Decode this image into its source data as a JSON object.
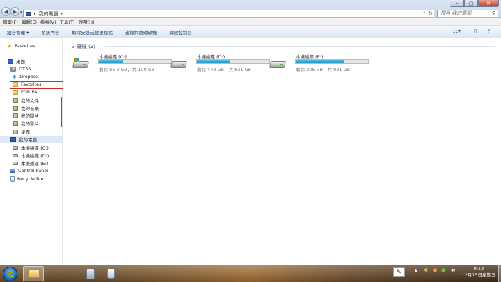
{
  "window": {
    "address_path": "我的電腦",
    "search_placeholder": "搜尋 我的電腦",
    "controls": {
      "minimize": "–",
      "maximize": "▢",
      "close": "✕"
    }
  },
  "menu": [
    "檔案(F)",
    "編輯(E)",
    "檢視(V)",
    "工具(T)",
    "說明(H)"
  ],
  "toolbar": [
    "組合管理 ▾",
    "系統內容",
    "解除安裝或變更程式",
    "連線網路磁碟機",
    "開啟控制台"
  ],
  "sidebar": {
    "favorites_header": "Favorites",
    "items": [
      {
        "label": "桌面",
        "icon": "desktop-icon"
      },
      {
        "label": "DTSS",
        "icon": "user-folder-icon"
      },
      {
        "label": "Dropbox",
        "icon": "dropbox-icon"
      },
      {
        "label": "Favorites",
        "icon": "folder-icon"
      },
      {
        "label": "FOR PA",
        "icon": "folder-icon"
      },
      {
        "label": "我的文件",
        "icon": "library-icon"
      },
      {
        "label": "我的音樂",
        "icon": "library-icon"
      },
      {
        "label": "我的圖片",
        "icon": "library-icon"
      },
      {
        "label": "我的影片",
        "icon": "library-icon"
      },
      {
        "label": "桌面",
        "icon": "library-icon"
      },
      {
        "label": "我的電腦",
        "icon": "computer-icon"
      },
      {
        "label": "本機磁碟 (C:)",
        "icon": "drive-icon"
      },
      {
        "label": "本機磁碟 (D:)",
        "icon": "drive-icon"
      },
      {
        "label": "本機磁碟 (E:)",
        "icon": "drive-icon"
      },
      {
        "label": "Control Panel",
        "icon": "control-panel-icon"
      },
      {
        "label": "Recycle Bin",
        "icon": "recycle-bin-icon"
      }
    ]
  },
  "content": {
    "group_header": "硬碟 (3)",
    "drives": [
      {
        "name": "本機磁碟 (C:)",
        "free_text": "剩餘 66.3 GB，共 100 GB",
        "used_fraction": 0.34
      },
      {
        "name": "本機磁碟 (D:)",
        "free_text": "剩餘 448 GB，共 831 GB",
        "used_fraction": 0.46
      },
      {
        "name": "本機磁碟 (E:)",
        "free_text": "剩餘 306 GB，共 931 GB",
        "used_fraction": 0.67
      }
    ]
  },
  "taskbar": {
    "clock_time": "9:13",
    "clock_date": "12月15日星期五"
  },
  "colors": {
    "drive_bar": "#1b8fc0",
    "highlight_box": "#d22a2a",
    "selected_row": "#dde8f6"
  }
}
